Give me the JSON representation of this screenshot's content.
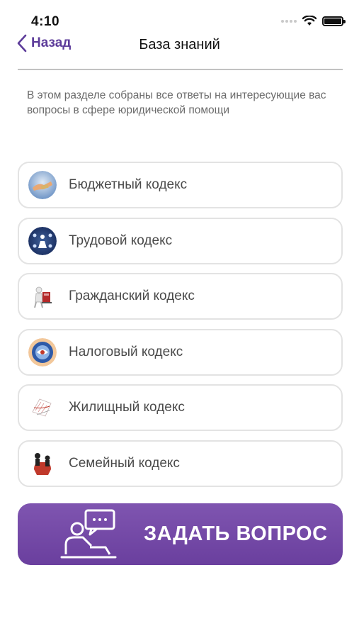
{
  "status_bar": {
    "time": "4:10",
    "icons": [
      "signal-dots-icon",
      "wifi-icon",
      "battery-icon"
    ]
  },
  "nav": {
    "back_label": "Назад",
    "back_icon": "chevron-left-icon",
    "title": "База знаний"
  },
  "intro": {
    "text": "В этом разделе собраны все ответы на интересующие вас вопросы в сфере юридической помощи"
  },
  "codes": [
    {
      "label": "Бюджетный кодекс",
      "icon": "budget-code-icon"
    },
    {
      "label": "Трудовой кодекс",
      "icon": "labor-code-icon"
    },
    {
      "label": "Гражданский кодекс",
      "icon": "civil-code-icon"
    },
    {
      "label": "Налоговый кодекс",
      "icon": "tax-code-icon"
    },
    {
      "label": "Жилищный кодекс",
      "icon": "housing-code-icon"
    },
    {
      "label": "Семейный кодекс",
      "icon": "family-code-icon"
    }
  ],
  "ask_button": {
    "label": "ЗАДАТЬ ВОПРОС",
    "icon": "consultant-chat-icon"
  },
  "colors": {
    "accent": "#5d3c9a",
    "button_top": "#7f55b0",
    "button_bottom": "#6a3f9e",
    "card_border": "#e3e3e3",
    "divider": "#c2c2c2"
  }
}
